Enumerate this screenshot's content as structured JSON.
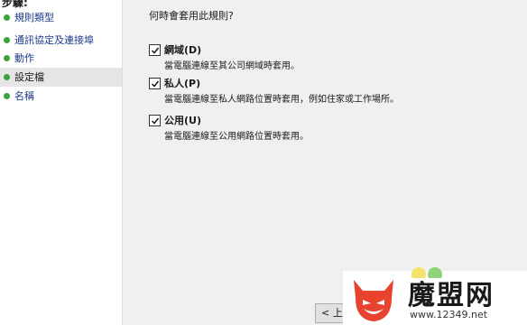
{
  "steps": {
    "header": "步驟:",
    "items": [
      {
        "label": "規則類型"
      },
      {
        "label": "通訊協定及連接埠"
      },
      {
        "label": "動作"
      },
      {
        "label": "設定檔"
      },
      {
        "label": "名稱"
      }
    ],
    "active_index": 3
  },
  "main": {
    "question": "何時會套用此規則?",
    "options": [
      {
        "label": "網域(D)",
        "description": "當電腦連線至其公司網域時套用。",
        "checked": true
      },
      {
        "label": "私人(P)",
        "description": "當電腦連線至私人網路位置時套用，例如住家或工作場所。",
        "checked": true
      },
      {
        "label": "公用(U)",
        "description": "當電腦連線至公用網路位置時套用。",
        "checked": true
      }
    ],
    "back_button": "< 上一"
  },
  "watermark": {
    "title": "魔盟网",
    "url": "www.12349.net"
  },
  "colors": {
    "step_dot": "#3aa33a",
    "watermark_red": "#e8432e",
    "link_text": "#1f3a8a"
  }
}
